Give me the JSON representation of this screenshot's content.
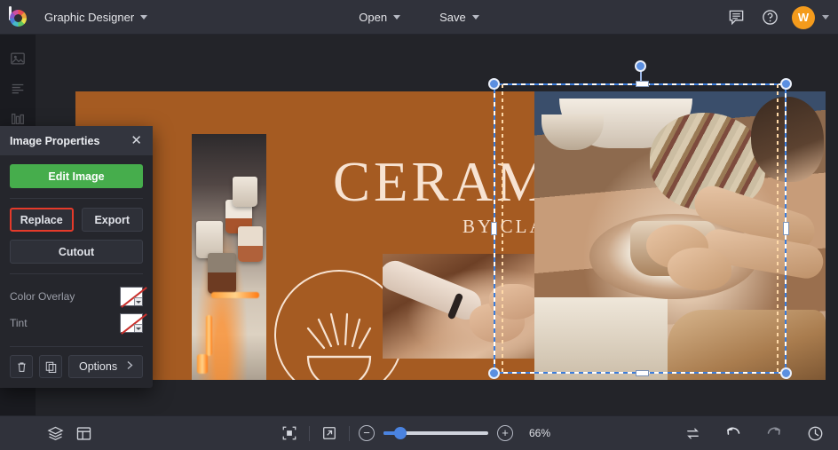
{
  "app": {
    "document_title": "Graphic Designer",
    "logo_icon": "color-wheel-logo-icon"
  },
  "topbar": {
    "open_label": "Open",
    "save_label": "Save",
    "comments_icon": "comment-icon",
    "help_icon": "question-circle-icon",
    "avatar_initial": "W",
    "avatar_color": "#f49b1c"
  },
  "left_rail": {
    "items": [
      {
        "icon": "image-icon",
        "name": "sidebar-item-images"
      },
      {
        "icon": "text-lines-icon",
        "name": "sidebar-item-text"
      },
      {
        "icon": "chart-bars-icon",
        "name": "sidebar-item-elements"
      }
    ]
  },
  "panel": {
    "title": "Image Properties",
    "close_icon": "close-icon",
    "edit_image_label": "Edit Image",
    "replace_label": "Replace",
    "export_label": "Export",
    "cutout_label": "Cutout",
    "color_overlay_label": "Color Overlay",
    "color_overlay_value": "none",
    "tint_label": "Tint",
    "tint_value": "none",
    "delete_icon": "trash-icon",
    "duplicate_icon": "duplicate-icon",
    "options_label": "Options",
    "options_chevron": "chevron-right-icon",
    "highlight_color": "#e53a2a",
    "primary_color": "#46ad4c"
  },
  "canvas": {
    "artboard_background": "#a55b22",
    "headline": "CERAMICS",
    "subline": "BY CLARA",
    "text_color": "#f7e3d2",
    "logo_mark_icon": "bowl-with-rays-mark-icon",
    "selection": {
      "handle_color": "#5b8fe0",
      "guide_color": "#ffd9a8",
      "rotation_handle_icon": "rotate-handle-icon"
    }
  },
  "bottombar": {
    "layers_icon": "layers-icon",
    "pages_icon": "page-layout-icon",
    "fit_icon": "fit-to-screen-icon",
    "present_icon": "open-external-icon",
    "zoom_out_icon": "minus-icon",
    "zoom_in_icon": "plus-icon",
    "zoom_value": "66%",
    "zoom_slider_percent": 18,
    "swap_icon": "swap-arrows-icon",
    "undo_icon": "undo-icon",
    "redo_icon": "redo-icon",
    "history_icon": "history-clock-icon"
  }
}
